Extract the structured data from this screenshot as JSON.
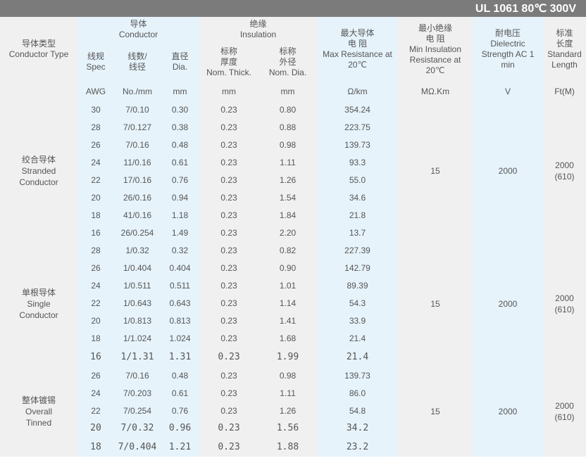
{
  "title": "UL 1061 80℃ 300V",
  "headers": {
    "conductor_type": [
      "导体类型",
      "Conductor Type"
    ],
    "conductor": [
      "导体",
      "Conductor"
    ],
    "insulation": [
      "绝缘",
      "Insulation"
    ],
    "max_resistance": [
      "最大导体",
      "电  阻",
      "Max Resistance at",
      "20℃"
    ],
    "min_insulation": [
      "最小绝缘",
      "电  阻",
      "Min Insulation",
      "Resistance at",
      "20℃"
    ],
    "dielectric": [
      "耐电压",
      "Dielectric",
      "Strength AC 1",
      "min"
    ],
    "standard_length": [
      "标准",
      "长度",
      "Standard",
      "Length"
    ],
    "spec": [
      "线规",
      "Spec"
    ],
    "strand": [
      "线数/",
      "线径"
    ],
    "diameter": [
      "直径",
      "Dia."
    ],
    "thickness": [
      "标称",
      "厚度",
      "Nom. Thick."
    ],
    "outer_dia": [
      "标称",
      "外径",
      "Nom. Dia."
    ]
  },
  "units": [
    "AWG",
    "No./mm",
    "mm",
    "mm",
    "mm",
    "Ω/km",
    "MΩ.Km",
    "V",
    "Ft(M)"
  ],
  "groups": [
    {
      "label": [
        "绞合导体",
        "Stranded",
        "Conductor"
      ],
      "insulation_resistance": "15",
      "dielectric": "2000",
      "length": [
        "2000",
        "(610)"
      ],
      "rows": [
        [
          "30",
          "7/0.10",
          "0.30",
          "0.23",
          "0.80",
          "354.24"
        ],
        [
          "28",
          "7/0.127",
          "0.38",
          "0.23",
          "0.88",
          "223.75"
        ],
        [
          "26",
          "7/0.16",
          "0.48",
          "0.23",
          "0.98",
          "139.73"
        ],
        [
          "24",
          "11/0.16",
          "0.61",
          "0.23",
          "1.11",
          "93.3"
        ],
        [
          "22",
          "17/0.16",
          "0.76",
          "0.23",
          "1.26",
          "55.0"
        ],
        [
          "20",
          "26/0.16",
          "0.94",
          "0.23",
          "1.54",
          "34.6"
        ],
        [
          "18",
          "41/0.16",
          "1.18",
          "0.23",
          "1.84",
          "21.8"
        ],
        [
          "16",
          "26/0.254",
          "1.49",
          "0.23",
          "2.20",
          "13.7"
        ]
      ]
    },
    {
      "label": [
        "单根导体",
        "Single",
        "Conductor"
      ],
      "insulation_resistance": "15",
      "dielectric": "2000",
      "length": [
        "2000",
        "(610)"
      ],
      "rows": [
        [
          "28",
          "1/0.32",
          "0.32",
          "0.23",
          "0.82",
          "227.39"
        ],
        [
          "26",
          "1/0.404",
          "0.404",
          "0.23",
          "0.90",
          "142.79"
        ],
        [
          "24",
          "1/0.511",
          "0.511",
          "0.23",
          "1.01",
          "89.39"
        ],
        [
          "22",
          "1/0.643",
          "0.643",
          "0.23",
          "1.14",
          "54.3"
        ],
        [
          "20",
          "1/0.813",
          "0.813",
          "0.23",
          "1.41",
          "33.9"
        ],
        [
          "18",
          "1/1.024",
          "1.024",
          "0.23",
          "1.68",
          "21.4"
        ],
        [
          "16",
          "1/1.31",
          "1.31",
          "0.23",
          "1.99",
          "21.4"
        ]
      ]
    },
    {
      "label": [
        "整体镀锡",
        "Overall",
        "Tinned"
      ],
      "insulation_resistance": "15",
      "dielectric": "2000",
      "length": [
        "2000",
        "(610)"
      ],
      "rows": [
        [
          "26",
          "7/0.16",
          "0.48",
          "0.23",
          "0.98",
          "139.73"
        ],
        [
          "24",
          "7/0.203",
          "0.61",
          "0.23",
          "1.11",
          "86.0"
        ],
        [
          "22",
          "7/0.254",
          "0.76",
          "0.23",
          "1.26",
          "54.8"
        ],
        [
          "20",
          "7/0.32",
          "0.96",
          "0.23",
          "1.56",
          "34.2"
        ],
        [
          "18",
          "7/0.404",
          "1.21",
          "0.23",
          "1.88",
          "23.2"
        ]
      ]
    }
  ]
}
